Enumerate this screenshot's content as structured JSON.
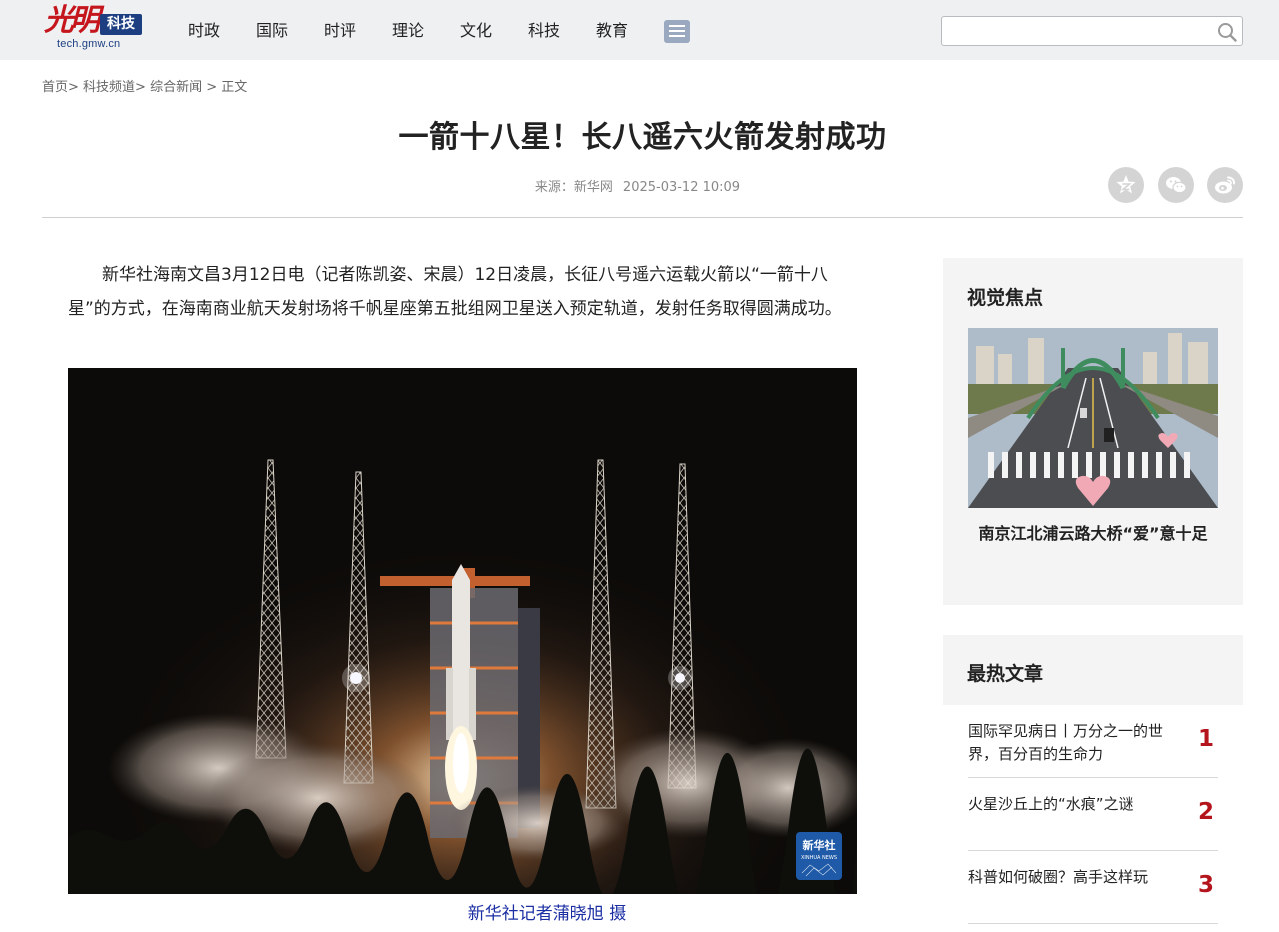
{
  "header": {
    "logo_brush": "光明",
    "logo_tag": "科技",
    "logo_url": "tech.gmw.cn",
    "nav": [
      "时政",
      "国际",
      "时评",
      "理论",
      "文化",
      "科技",
      "教育"
    ],
    "search_value": ""
  },
  "breadcrumb": {
    "home": "首页>",
    "channel": "科技频道>",
    "section": "综合新闻",
    "sep": ">",
    "current": "正文"
  },
  "article": {
    "title": "一箭十八星！长八遥六火箭发射成功",
    "source": "来源：新华网",
    "datetime": "2025-03-12 10:09",
    "lead": "新华社海南文昌3月12日电（记者陈凯姿、宋晨）12日凌晨，长征八号遥六运载火箭以“一箭十八星”的方式，在海南商业航天发射场将千帆星座第五批组网卫星送入预定轨道，发射任务取得圆满成功。",
    "photo_caption": "新华社记者蒲晓旭 摄",
    "photo_badge_top": "新华社",
    "photo_badge_bottom": "XINHUA NEWS"
  },
  "sidebar": {
    "focus_title": "视觉焦点",
    "focus_caption": "南京江北浦云路大桥“爱”意十足",
    "hot_title": "最热文章",
    "hot_items": [
      {
        "text": "国际罕见病日丨万分之一的世界，百分百的生命力",
        "rank": "1"
      },
      {
        "text": "火星沙丘上的“水痕”之谜",
        "rank": "2"
      },
      {
        "text": "科普如何破圈？高手这样玩",
        "rank": "3"
      }
    ]
  },
  "colors": {
    "brand_red": "#c4161c",
    "brand_blue": "#1d3f82",
    "rank_red": "#b4151c",
    "caption_blue": "#1b2fa3"
  }
}
